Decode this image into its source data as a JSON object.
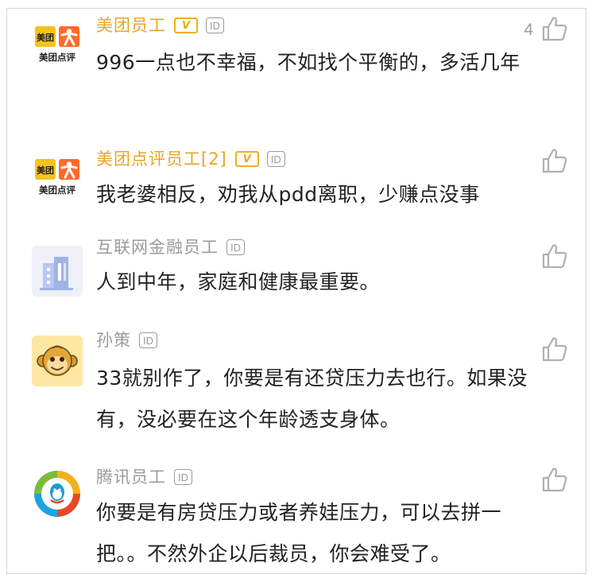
{
  "comments": [
    {
      "user": "美团员工",
      "verified_badge": "V",
      "id_badge": "ID",
      "text": "996一点也不幸福，不如找个平衡的，多活几年",
      "likes": "4",
      "avatar": {
        "icon": "meituan-dianping-logo",
        "lines": [
          "美团",
          "美团点评"
        ]
      }
    },
    {
      "user": "美团点评员工[2]",
      "verified_badge": "V",
      "id_badge": "ID",
      "text": "我老婆相反，劝我从pdd离职，少赚点没事",
      "avatar": {
        "icon": "meituan-dianping-logo",
        "lines": [
          "美团",
          "美团点评"
        ]
      }
    },
    {
      "user": "互联网金融员工",
      "id_badge": "ID",
      "text": "人到中年，家庭和健康最重要。",
      "avatar": {
        "icon": "building-icon"
      }
    },
    {
      "user": "孙策",
      "id_badge": "ID",
      "text": "33就别作了，你要是有还贷压力去也行。如果没有，没必要在这个年龄透支身体。",
      "avatar": {
        "icon": "monkey-icon"
      }
    },
    {
      "user": "腾讯员工",
      "id_badge": "ID",
      "text": "你要是有房贷压力或者养娃压力，可以去拼一把。。不然外企以后裁员，你会难受了。",
      "avatar": {
        "icon": "tencent-logo"
      }
    }
  ],
  "colors": {
    "accent_gold": "#e8a426",
    "muted": "#9b9b9b",
    "text": "#222222"
  }
}
